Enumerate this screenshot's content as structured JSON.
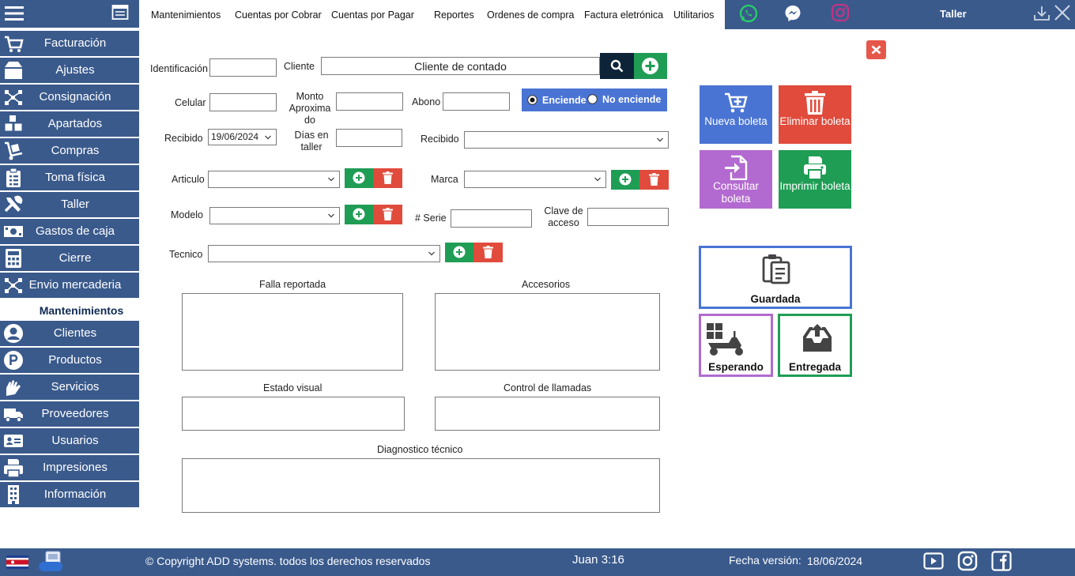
{
  "sidebar": {
    "items": [
      {
        "label": "Facturación",
        "icon": "cart-icon"
      },
      {
        "label": "Ajustes",
        "icon": "box-icon"
      },
      {
        "label": "Consignación",
        "icon": "network-icon"
      },
      {
        "label": "Apartados",
        "icon": "boxes-icon"
      },
      {
        "label": "Compras",
        "icon": "dolly-icon"
      },
      {
        "label": "Toma física",
        "icon": "clipboard-icon"
      },
      {
        "label": "Taller",
        "icon": "tools-icon"
      },
      {
        "label": "Gastos de caja",
        "icon": "money-icon"
      },
      {
        "label": "Cierre",
        "icon": "calculator-icon"
      },
      {
        "label": "Envio mercaderia",
        "icon": "network-icon"
      }
    ],
    "section_title": "Mantenimientos",
    "maint_items": [
      {
        "label": "Clientes",
        "icon": "user-icon"
      },
      {
        "label": "Productos",
        "icon": "product-icon"
      },
      {
        "label": "Servicios",
        "icon": "hands-icon"
      },
      {
        "label": "Proveedores",
        "icon": "truck-icon"
      },
      {
        "label": "Usuarios",
        "icon": "id-card-icon"
      },
      {
        "label": "Impresiones",
        "icon": "printer-icon"
      },
      {
        "label": "Información",
        "icon": "building-icon"
      }
    ]
  },
  "topmenu": {
    "items": [
      "Mantenimientos",
      "Cuentas por Cobrar",
      "Cuentas por Pagar",
      "Reportes",
      "Ordenes de compra",
      "Factura eletrónica",
      "Utilitarios"
    ],
    "module_title": "Taller"
  },
  "form": {
    "identificacion_label": "Identificación",
    "identificacion_value": "",
    "cliente_label": "Cliente",
    "cliente_value": "Cliente de contado",
    "celular_label": "Celular",
    "monto_label": "Monto Aproxima do",
    "abono_label": "Abono",
    "enciende_label": "Enciende",
    "no_enciende_label": "No enciende",
    "recibido_label": "Recibido",
    "recibido_date": "19/06/2024",
    "dias_label": "Días en taller",
    "recibido2_label": "Recibido",
    "articulo_label": "Articulo",
    "marca_label": "Marca",
    "modelo_label": "Modelo",
    "serie_label": "# Serie",
    "clave_label": "Clave de acceso",
    "tecnico_label": "Tecnico",
    "falla_label": "Falla reportada",
    "accesorios_label": "Accesorios",
    "estado_label": "Estado visual",
    "control_label": "Control de llamadas",
    "diagnostico_label": "Diagnostico técnico"
  },
  "actions": {
    "nueva": "Nueva boleta",
    "eliminar": "Eliminar boleta",
    "consultar": "Consultar boleta",
    "imprimir": "Imprimir boleta",
    "guardada": "Guardada",
    "esperando": "Esperando",
    "entregada": "Entregada"
  },
  "footer": {
    "copyright": "© Copyright ADD systems. todos los derechos reservados",
    "verse": "Juan 3:16",
    "version_label": "Fecha versión:",
    "version_date": "18/06/2024"
  },
  "colors": {
    "nav": "#3a5a8c",
    "green": "#1f9d55",
    "red": "#e04b3c",
    "blue": "#4a74d4",
    "purple": "#b36ad0",
    "dark": "#0d2438"
  }
}
